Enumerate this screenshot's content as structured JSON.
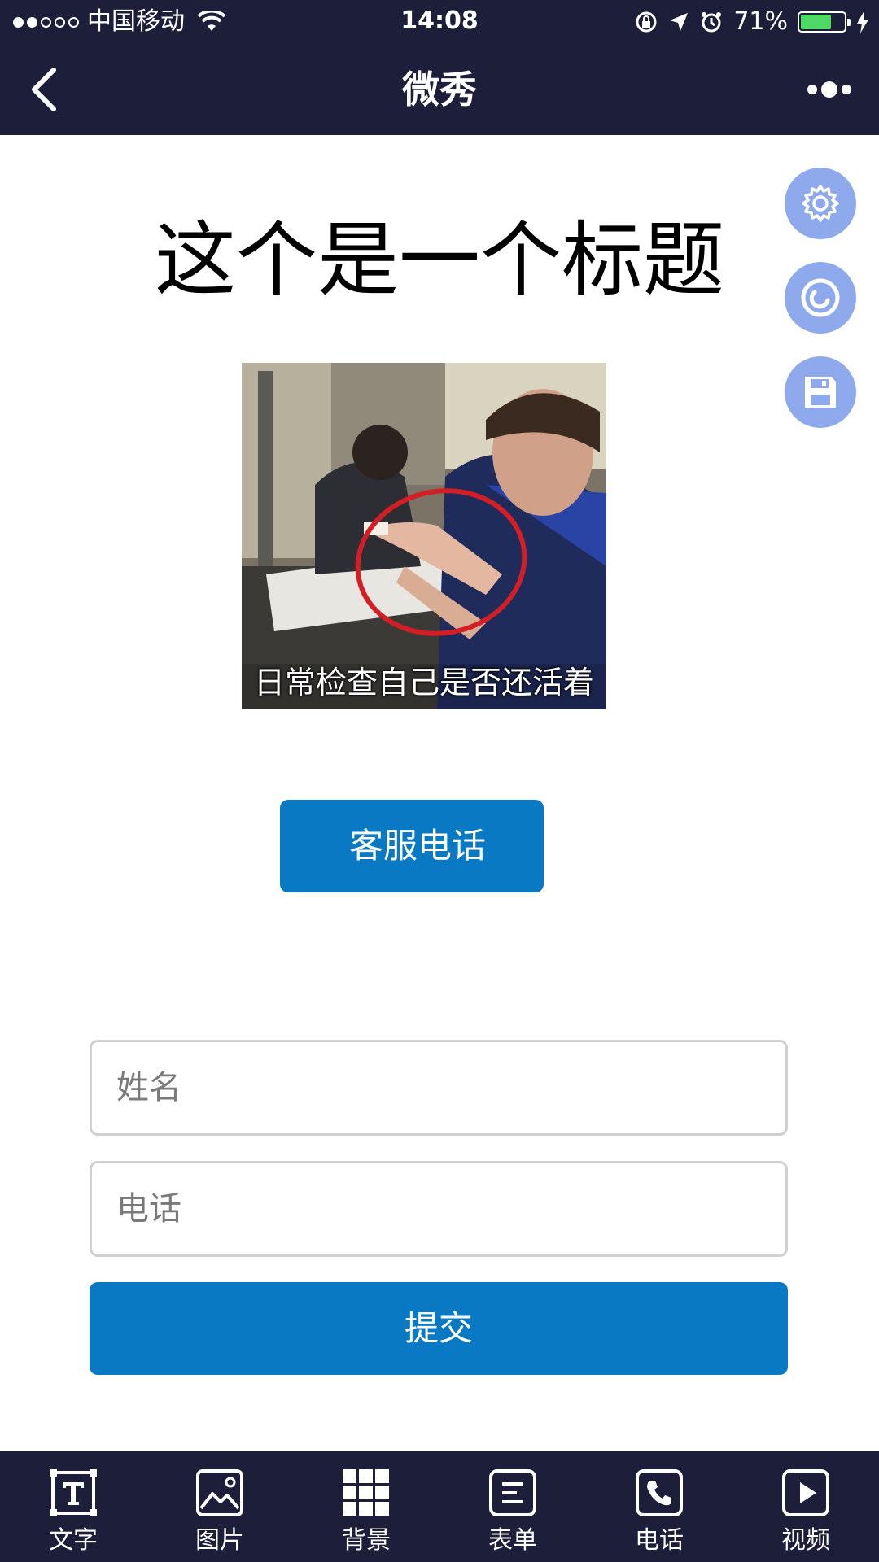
{
  "status_bar": {
    "carrier": "中国移动",
    "time": "14:08",
    "battery_percent": "71%",
    "battery_level": 0.71,
    "signal_bars": 2
  },
  "nav": {
    "title": "微秀"
  },
  "content": {
    "heading": "这个是一个标题",
    "image_caption": "日常检查自己是否还活着",
    "service_button": "客服电话",
    "form": {
      "name_placeholder": "姓名",
      "phone_placeholder": "电话",
      "submit_label": "提交"
    }
  },
  "side_tools": [
    {
      "icon": "gear-icon"
    },
    {
      "icon": "preview-icon"
    },
    {
      "icon": "save-icon"
    }
  ],
  "toolbar": {
    "items": [
      {
        "label": "文字",
        "icon": "text-icon"
      },
      {
        "label": "图片",
        "icon": "image-icon"
      },
      {
        "label": "背景",
        "icon": "grid-icon"
      },
      {
        "label": "表单",
        "icon": "form-icon"
      },
      {
        "label": "电话",
        "icon": "phone-icon"
      },
      {
        "label": "视频",
        "icon": "video-icon"
      }
    ]
  },
  "colors": {
    "bar_background": "#1d1f3a",
    "primary_button": "#0979c4",
    "side_tool": "#8ea9ec",
    "battery": "#4cd964"
  }
}
